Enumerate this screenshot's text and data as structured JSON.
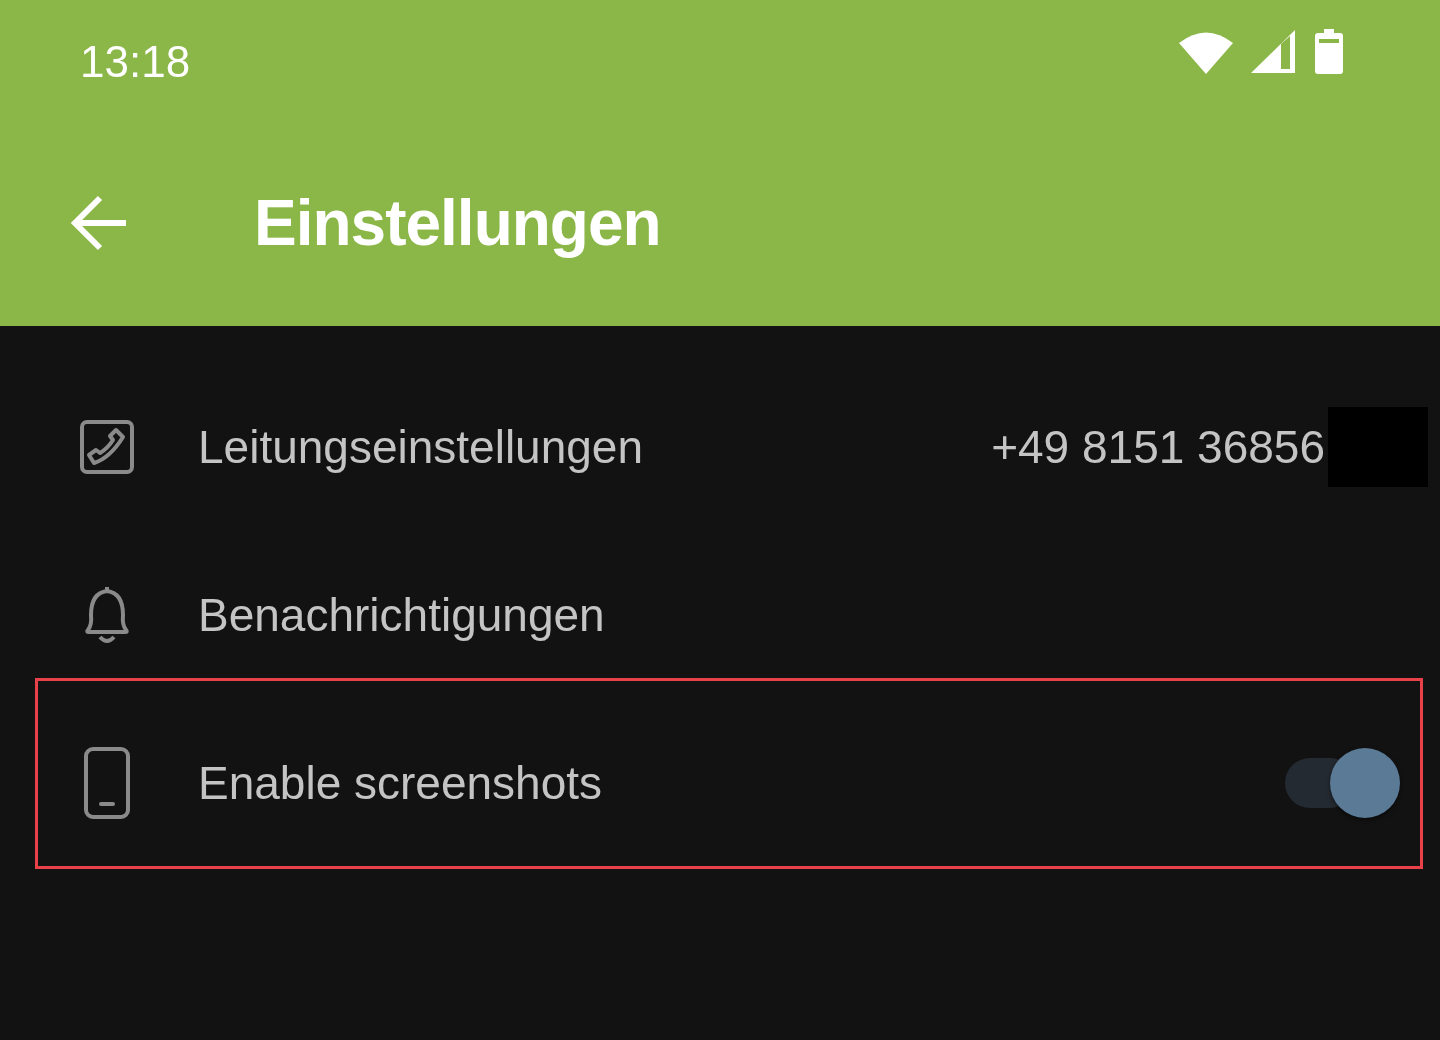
{
  "status_bar": {
    "time": "13:18"
  },
  "app_bar": {
    "title": "Einstellungen"
  },
  "settings": [
    {
      "kind": "link",
      "label": "Leitungseinstellungen",
      "value": "+49 8151 36856",
      "redacted": true,
      "highlighted": false
    },
    {
      "kind": "link",
      "label": "Benachrichtigungen",
      "highlighted": false
    },
    {
      "kind": "toggle",
      "label": "Enable screenshots",
      "on": true,
      "highlighted": true
    }
  ]
}
